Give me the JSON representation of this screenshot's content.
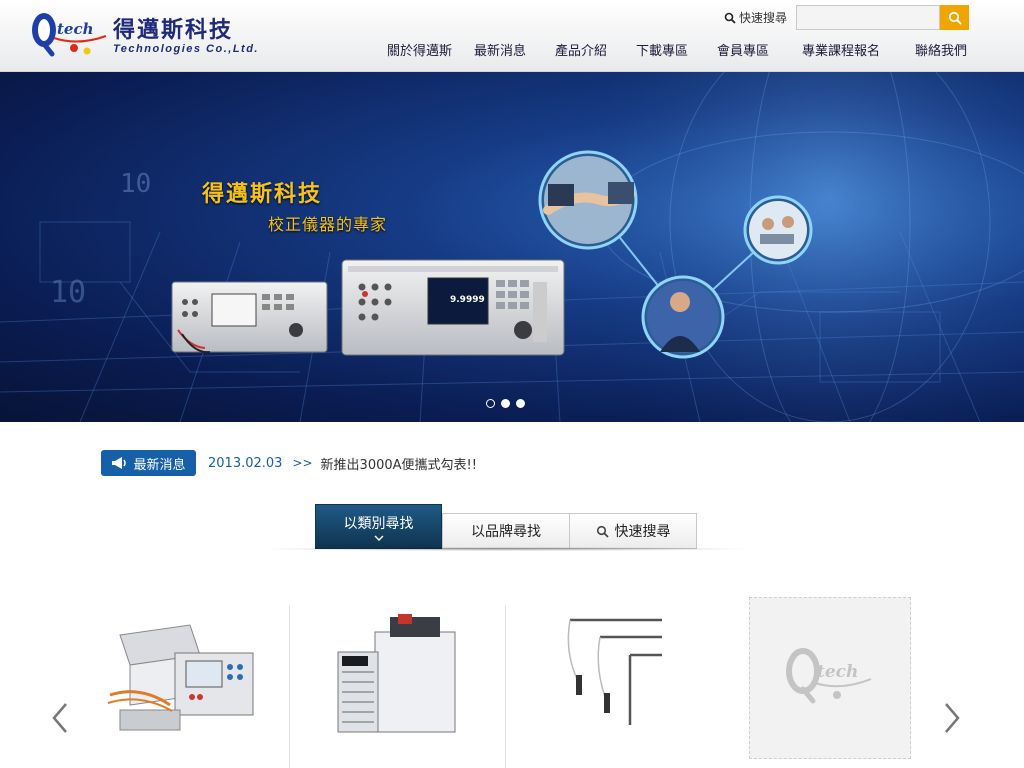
{
  "header": {
    "logo_mark_text": "Qtech",
    "logo_cn": "得邁斯科技",
    "logo_en": "Technologies Co.,Ltd.",
    "search": {
      "label": "快速搜尋",
      "placeholder": "",
      "button_icon": "search-icon"
    }
  },
  "nav": [
    {
      "label": "關於得邁斯"
    },
    {
      "label": "最新消息"
    },
    {
      "label": "產品介紹"
    },
    {
      "label": "下載專區"
    },
    {
      "label": "會員專區"
    },
    {
      "label": "專業課程報名"
    },
    {
      "label": "聯絡我們"
    }
  ],
  "banner": {
    "title": "得邁斯科技",
    "subtitle": "校正儀器的專家",
    "device_readout": "9.9999",
    "slides": 3,
    "active_slide": 2
  },
  "news": {
    "badge_label": "最新消息",
    "badge_icon": "megaphone-icon",
    "date": "2013.02.03",
    "arrow": ">>",
    "text": "新推出3000A便攜式勾表!!"
  },
  "tabs": [
    {
      "label": "以類別尋找",
      "active": true,
      "icon": "chevron-down-icon"
    },
    {
      "label": "以品牌尋找",
      "active": false
    },
    {
      "label": "快速搜尋",
      "active": false,
      "icon": "search-icon"
    }
  ],
  "products": [
    {
      "name": "data-acquisition-unit"
    },
    {
      "name": "temperature-bath"
    },
    {
      "name": "thermocouple-probes"
    },
    {
      "name": "placeholder-logo",
      "logo_text": "Qtech"
    }
  ],
  "colors": {
    "brand_blue": "#1560a8",
    "nav_text": "#1c1c3a",
    "banner_gold": "#f4c21b",
    "search_button": "#f0a500",
    "tab_active": "#0f3350"
  }
}
